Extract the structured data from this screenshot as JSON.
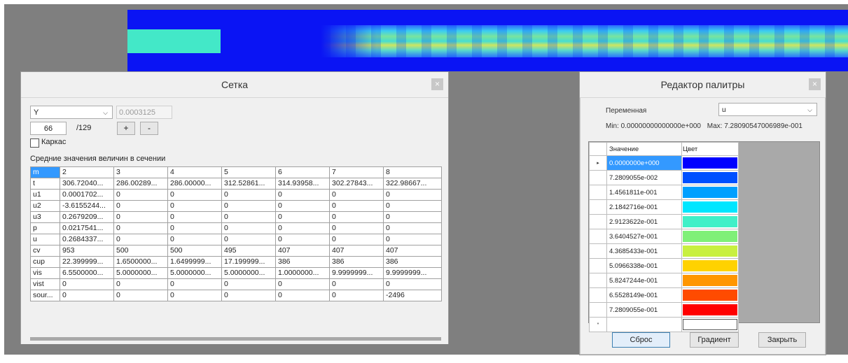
{
  "grid_window": {
    "title": "Сетка",
    "close_glyph": "×",
    "axis_select": "Y",
    "step_value": "0.0003125",
    "index_value": "66",
    "index_total": "/129",
    "plus_label": "+",
    "minus_label": "-",
    "wireframe_label": "Каркас",
    "section_title": "Средние значения величин в сечении",
    "table": {
      "rows": [
        [
          "m",
          "2",
          "3",
          "4",
          "5",
          "6",
          "7",
          "8"
        ],
        [
          "t",
          "306.72040...",
          "286.00289...",
          "286.00000...",
          "312.52861...",
          "314.93958...",
          "302.27843...",
          "322.98667..."
        ],
        [
          "u1",
          "0.0001702...",
          "0",
          "0",
          "0",
          "0",
          "0",
          "0"
        ],
        [
          "u2",
          "-3.6155244...",
          "0",
          "0",
          "0",
          "0",
          "0",
          "0"
        ],
        [
          "u3",
          "0.2679209...",
          "0",
          "0",
          "0",
          "0",
          "0",
          "0"
        ],
        [
          "p",
          "0.0217541...",
          "0",
          "0",
          "0",
          "0",
          "0",
          "0"
        ],
        [
          "u",
          "0.2684337...",
          "0",
          "0",
          "0",
          "0",
          "0",
          "0"
        ],
        [
          "cv",
          "953",
          "500",
          "500",
          "495",
          "407",
          "407",
          "407"
        ],
        [
          "cup",
          "22.399999...",
          "1.6500000...",
          "1.6499999...",
          "17.199999...",
          "386",
          "386",
          "386"
        ],
        [
          "vis",
          "6.5500000...",
          "5.0000000...",
          "5.0000000...",
          "5.0000000...",
          "1.0000000...",
          "9.9999999...",
          "9.9999999..."
        ],
        [
          "vist",
          "0",
          "0",
          "0",
          "0",
          "0",
          "0",
          "0"
        ],
        [
          "sour...",
          "0",
          "0",
          "0",
          "0",
          "0",
          "0",
          "-2496"
        ]
      ]
    }
  },
  "palette_window": {
    "title": "Редактор палитры",
    "close_glyph": "×",
    "variable_label": "Переменная",
    "variable_value": "u",
    "min_text": "Min: 0.00000000000000e+000",
    "max_text": "Max: 7.28090547006989e-001",
    "value_header": "Значение",
    "color_header": "Цвет",
    "entries": [
      {
        "value": "0.0000000e+000",
        "color": "#0000ff"
      },
      {
        "value": "7.2809055e-002",
        "color": "#0050ff"
      },
      {
        "value": "1.4561811e-001",
        "color": "#00a0ff"
      },
      {
        "value": "2.1842716e-001",
        "color": "#00e6ff"
      },
      {
        "value": "2.9123622e-001",
        "color": "#40f0c8"
      },
      {
        "value": "3.6404527e-001",
        "color": "#7ff078"
      },
      {
        "value": "4.3685433e-001",
        "color": "#c8f040"
      },
      {
        "value": "5.0966338e-001",
        "color": "#ffd200"
      },
      {
        "value": "5.8247244e-001",
        "color": "#ff9600"
      },
      {
        "value": "6.5528149e-001",
        "color": "#ff4b00"
      },
      {
        "value": "7.2809055e-001",
        "color": "#ff0000"
      }
    ],
    "new_row_color": "#ffffff",
    "selected_row_marker": "▸",
    "new_row_marker": "*",
    "reset_button": "Сброс",
    "gradient_button": "Градиент",
    "close_button": "Закрыть"
  },
  "viz": {
    "background_color": "#0a14f4",
    "inlet_color": "#43e8c8"
  }
}
